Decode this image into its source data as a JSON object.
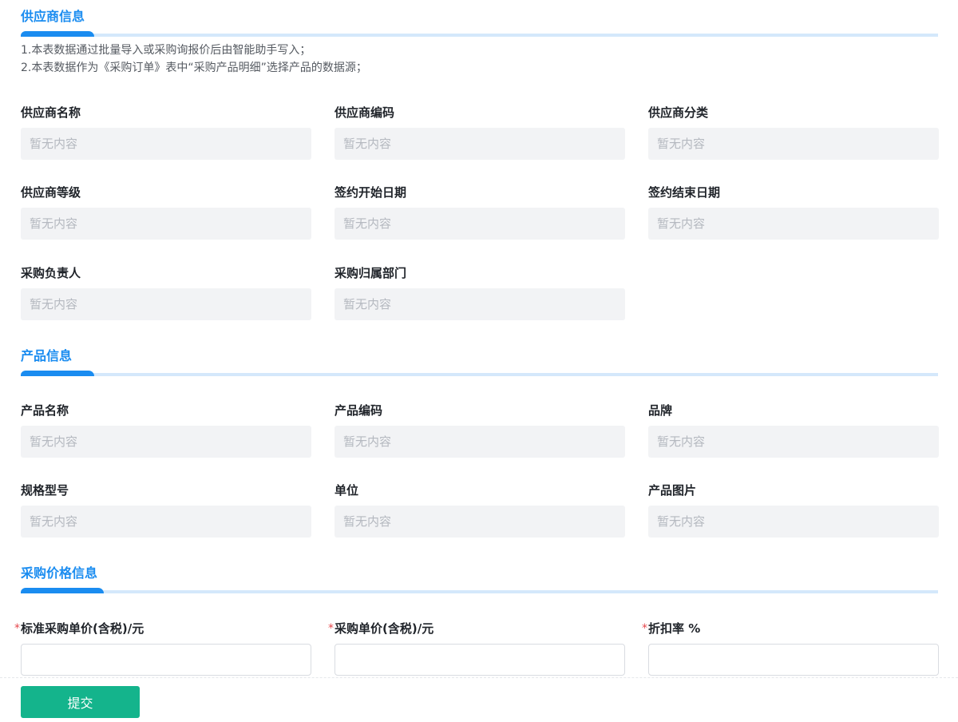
{
  "sections": {
    "supplier": {
      "title": "供应商信息",
      "notes": [
        "1.本表数据通过批量导入或采购询报价后由智能助手写入；",
        "2.本表数据作为《采购订单》表中“采购产品明细”选择产品的数据源；"
      ],
      "fields": [
        {
          "label": "供应商名称",
          "value": "暂无内容"
        },
        {
          "label": "供应商编码",
          "value": "暂无内容"
        },
        {
          "label": "供应商分类",
          "value": "暂无内容"
        },
        {
          "label": "供应商等级",
          "value": "暂无内容"
        },
        {
          "label": "签约开始日期",
          "value": "暂无内容"
        },
        {
          "label": "签约结束日期",
          "value": "暂无内容"
        },
        {
          "label": "采购负责人",
          "value": "暂无内容"
        },
        {
          "label": "采购归属部门",
          "value": "暂无内容"
        }
      ]
    },
    "product": {
      "title": "产品信息",
      "fields": [
        {
          "label": "产品名称",
          "value": "暂无内容"
        },
        {
          "label": "产品编码",
          "value": "暂无内容"
        },
        {
          "label": "品牌",
          "value": "暂无内容"
        },
        {
          "label": "规格型号",
          "value": "暂无内容"
        },
        {
          "label": "单位",
          "value": "暂无内容"
        },
        {
          "label": "产品图片",
          "value": "暂无内容"
        }
      ]
    },
    "price": {
      "title": "采购价格信息",
      "fields": [
        {
          "label": "标准采购单价(含税)/元",
          "required_mark": "*",
          "value": ""
        },
        {
          "label": "采购单价(含税)/元",
          "required_mark": "*",
          "value": ""
        },
        {
          "label": "折扣率 %",
          "required_mark": "*",
          "value": ""
        }
      ]
    }
  },
  "footer": {
    "submit_label": "提交"
  },
  "colors": {
    "accent": "#1a8cf0",
    "accent_light": "#d4e8fb",
    "submit": "#14b48c",
    "required": "#e5484d",
    "placeholder_text": "#b4b8bf",
    "readonly_bg": "#f2f3f5"
  }
}
